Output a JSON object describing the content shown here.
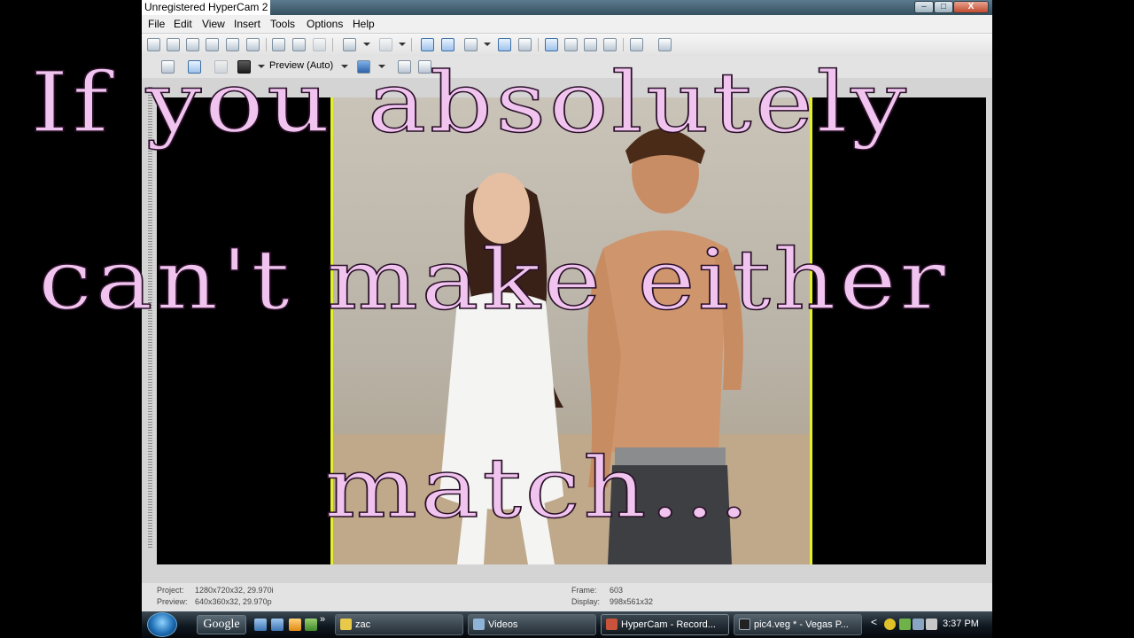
{
  "window": {
    "recorder_label": "Unregistered HyperCam 2",
    "minimize_glyph": "–",
    "maximize_glyph": "□",
    "close_glyph": "X"
  },
  "menu": [
    "File",
    "Edit",
    "View",
    "Insert",
    "Tools",
    "Options",
    "Help"
  ],
  "preview_toolbar": {
    "mode_label": "Preview (Auto)"
  },
  "status": {
    "project_label": "Project:",
    "project_value": "1280x720x32, 29.970i",
    "preview_label": "Preview:",
    "preview_value": "640x360x32, 29.970p",
    "frame_label": "Frame:",
    "frame_value": "603",
    "display_label": "Display:",
    "display_value": "998x561x32"
  },
  "caption": {
    "line1": "If you absolutely",
    "line2": "can't make either",
    "line3": "match..."
  },
  "taskbar": {
    "search_label": "Google",
    "more_glyph": "»",
    "tasks": [
      {
        "label": "zac"
      },
      {
        "label": "Videos"
      },
      {
        "label": "HyperCam - Record..."
      },
      {
        "label": "pic4.veg * - Vegas P..."
      }
    ],
    "tray_chevron": "<",
    "clock": "3:37 PM"
  },
  "colors": {
    "caption_fill": "#f0c4ee",
    "title_gradient_top": "#5c7a8e",
    "photo_border": "#e6f02a",
    "taskbar": "#101820"
  }
}
